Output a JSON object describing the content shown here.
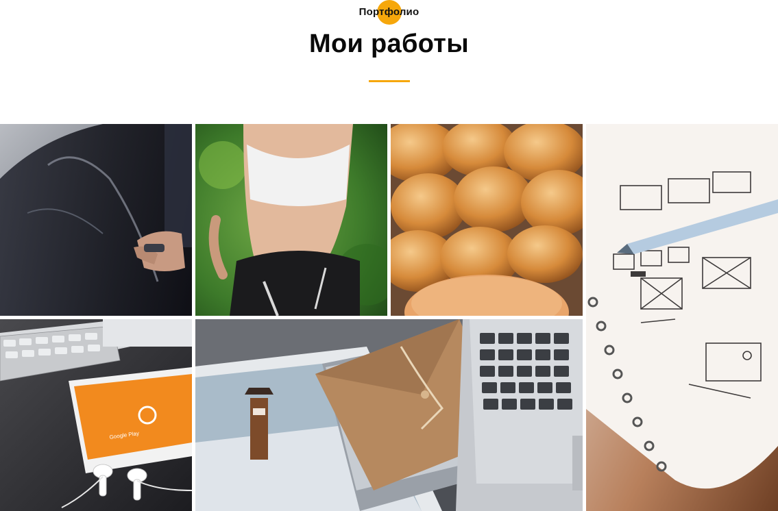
{
  "section": {
    "eyebrow": "Портфолио",
    "title": "Мои работы"
  },
  "colors": {
    "accent": "#f6a70b",
    "text": "#0a0a0a",
    "background": "#ffffff"
  },
  "portfolio": {
    "items": [
      {
        "name": "car-door-photo"
      },
      {
        "name": "fitness-runner-photo"
      },
      {
        "name": "bread-loaves-photo"
      },
      {
        "name": "wireframe-notebook-photo"
      },
      {
        "name": "phone-keyboard-photo"
      },
      {
        "name": "photos-envelope-laptop-photo"
      }
    ],
    "phone_app_label": "Google Play"
  }
}
